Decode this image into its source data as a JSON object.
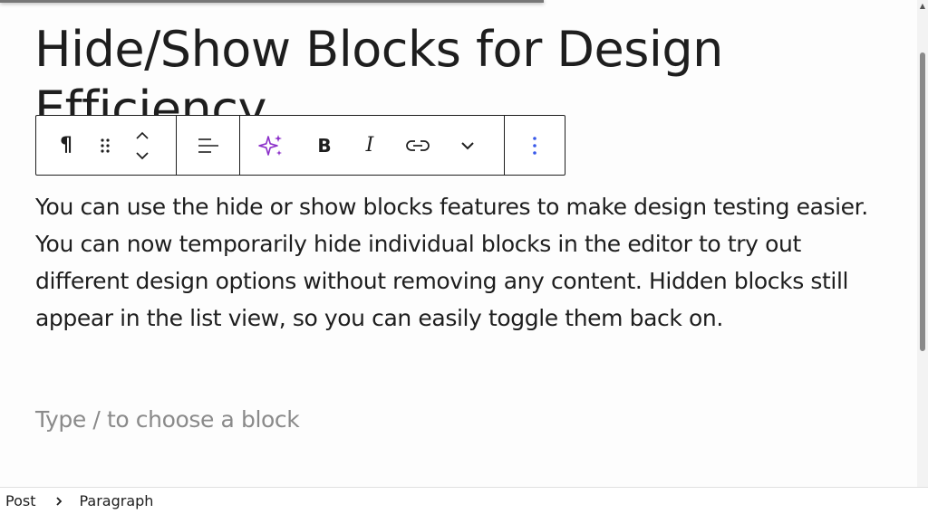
{
  "post": {
    "title": "Hide/Show Blocks for Design Efficiency",
    "paragraph": "You can use the hide or show blocks features to make design testing easier. You can now temporarily hide individual blocks in the editor to try out different design options without removing any content. Hidden blocks still appear in the list view, so you can easily toggle them back on.",
    "placeholder": "Type / to choose a block"
  },
  "toolbar": {
    "paragraph_icon_label": "¶",
    "bold_label": "B",
    "italic_label": "I"
  },
  "breadcrumb": {
    "items": [
      "Post",
      "Paragraph"
    ]
  },
  "colors": {
    "text": "#1e1e1e",
    "placeholder": "#8a8a8a",
    "ai_accent": "#8b2fc9",
    "more_accent": "#3858e9"
  },
  "icons": {
    "block_type": "paragraph-icon",
    "drag": "drag-handle-icon",
    "move_up": "chevron-up-icon",
    "move_down": "chevron-down-icon",
    "align": "align-left-icon",
    "ai": "sparkle-icon",
    "link": "link-icon",
    "more_formatting": "chevron-down-icon",
    "options": "more-vertical-icon",
    "breadcrumb_separator": "chevron-right-icon"
  }
}
